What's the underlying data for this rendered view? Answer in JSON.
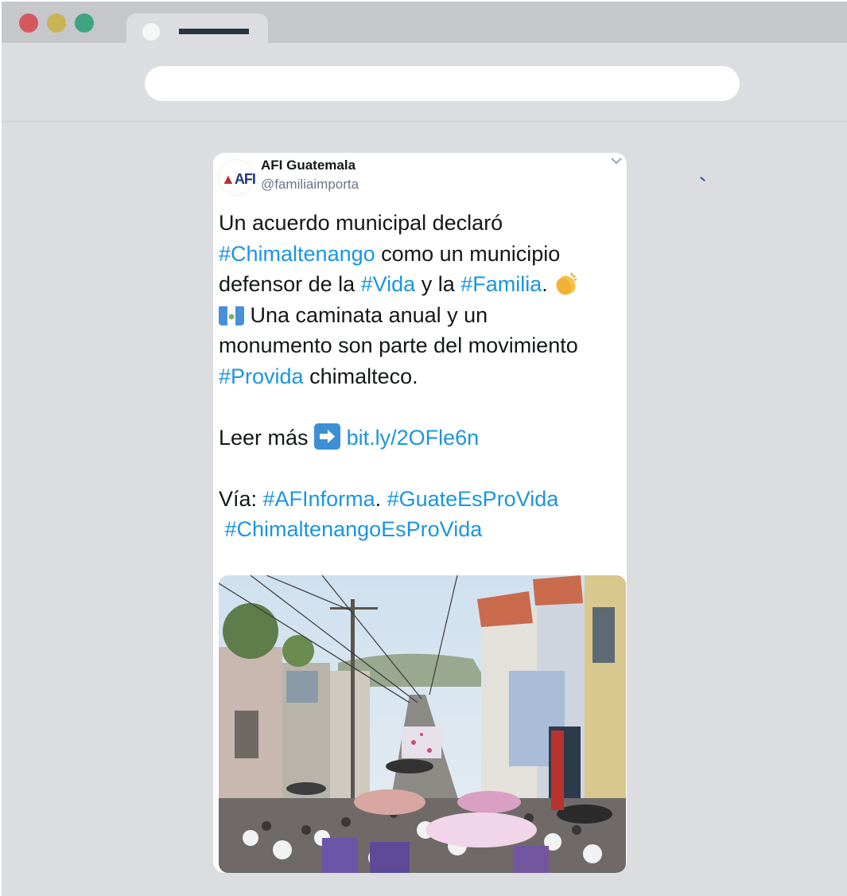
{
  "browser": {
    "controls": {
      "close_color": "#d4595f",
      "minimize_color": "#c9b356",
      "maximize_color": "#3fa57f"
    },
    "address_bar_value": ""
  },
  "tweet": {
    "author_name": "AFI Guatemala",
    "handle": "@familiaimporta",
    "avatar_logo_text": "AFI",
    "menu_icon": "chevron-down-icon",
    "text": {
      "l1": "Un acuerdo municipal declaró",
      "l2_tag": "#Chimaltenango",
      "l2_rest": " como un municipio",
      "l3_pre": "defensor de la ",
      "l3_tag1": "#Vida",
      "l3_mid": " y la ",
      "l3_tag2": "#Familia",
      "l3_post": ". ",
      "l4_rest": " Una caminata anual y un",
      "l5": "monumento son parte del movimiento",
      "l6_tag": "#Provida",
      "l6_rest": " chimalteco.",
      "l8_pre": "Leer más ",
      "l8_link": "bit.ly/2OFle6n",
      "l10_pre": "Vía: ",
      "l10_tag1": "#AFInforma",
      "l10_mid": ". ",
      "l10_tag2": "#GuateEsProVida",
      "l11_tag": " #ChimaltenangoEsProVida"
    },
    "emoji": [
      "clapping-hands-icon",
      "guatemala-flag-icon",
      "right-arrow-icon"
    ],
    "link_color": "#1b95e0"
  }
}
